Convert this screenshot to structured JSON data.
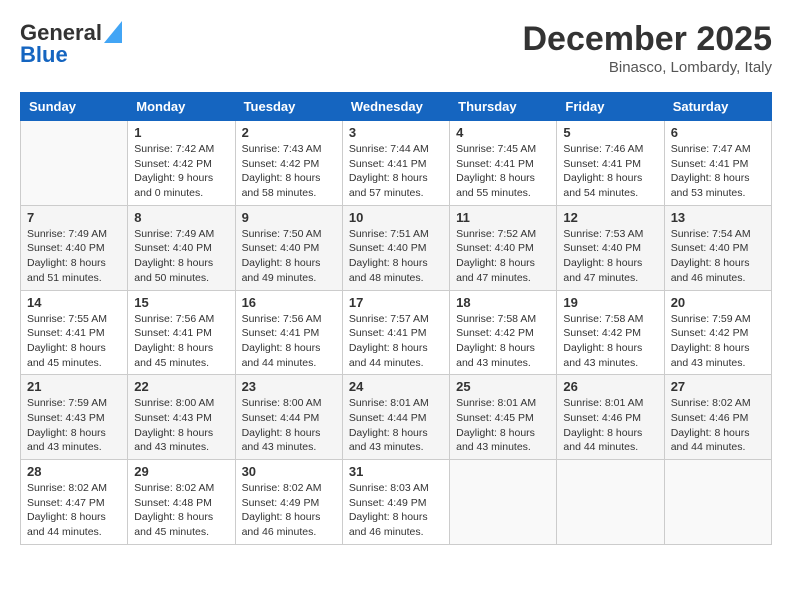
{
  "logo": {
    "line1": "General",
    "line2": "Blue"
  },
  "title": "December 2025",
  "location": "Binasco, Lombardy, Italy",
  "days_header": [
    "Sunday",
    "Monday",
    "Tuesday",
    "Wednesday",
    "Thursday",
    "Friday",
    "Saturday"
  ],
  "weeks": [
    [
      {
        "day": "",
        "info": ""
      },
      {
        "day": "1",
        "info": "Sunrise: 7:42 AM\nSunset: 4:42 PM\nDaylight: 9 hours\nand 0 minutes."
      },
      {
        "day": "2",
        "info": "Sunrise: 7:43 AM\nSunset: 4:42 PM\nDaylight: 8 hours\nand 58 minutes."
      },
      {
        "day": "3",
        "info": "Sunrise: 7:44 AM\nSunset: 4:41 PM\nDaylight: 8 hours\nand 57 minutes."
      },
      {
        "day": "4",
        "info": "Sunrise: 7:45 AM\nSunset: 4:41 PM\nDaylight: 8 hours\nand 55 minutes."
      },
      {
        "day": "5",
        "info": "Sunrise: 7:46 AM\nSunset: 4:41 PM\nDaylight: 8 hours\nand 54 minutes."
      },
      {
        "day": "6",
        "info": "Sunrise: 7:47 AM\nSunset: 4:41 PM\nDaylight: 8 hours\nand 53 minutes."
      }
    ],
    [
      {
        "day": "7",
        "info": "Sunrise: 7:49 AM\nSunset: 4:40 PM\nDaylight: 8 hours\nand 51 minutes."
      },
      {
        "day": "8",
        "info": "Sunrise: 7:49 AM\nSunset: 4:40 PM\nDaylight: 8 hours\nand 50 minutes."
      },
      {
        "day": "9",
        "info": "Sunrise: 7:50 AM\nSunset: 4:40 PM\nDaylight: 8 hours\nand 49 minutes."
      },
      {
        "day": "10",
        "info": "Sunrise: 7:51 AM\nSunset: 4:40 PM\nDaylight: 8 hours\nand 48 minutes."
      },
      {
        "day": "11",
        "info": "Sunrise: 7:52 AM\nSunset: 4:40 PM\nDaylight: 8 hours\nand 47 minutes."
      },
      {
        "day": "12",
        "info": "Sunrise: 7:53 AM\nSunset: 4:40 PM\nDaylight: 8 hours\nand 47 minutes."
      },
      {
        "day": "13",
        "info": "Sunrise: 7:54 AM\nSunset: 4:40 PM\nDaylight: 8 hours\nand 46 minutes."
      }
    ],
    [
      {
        "day": "14",
        "info": "Sunrise: 7:55 AM\nSunset: 4:41 PM\nDaylight: 8 hours\nand 45 minutes."
      },
      {
        "day": "15",
        "info": "Sunrise: 7:56 AM\nSunset: 4:41 PM\nDaylight: 8 hours\nand 45 minutes."
      },
      {
        "day": "16",
        "info": "Sunrise: 7:56 AM\nSunset: 4:41 PM\nDaylight: 8 hours\nand 44 minutes."
      },
      {
        "day": "17",
        "info": "Sunrise: 7:57 AM\nSunset: 4:41 PM\nDaylight: 8 hours\nand 44 minutes."
      },
      {
        "day": "18",
        "info": "Sunrise: 7:58 AM\nSunset: 4:42 PM\nDaylight: 8 hours\nand 43 minutes."
      },
      {
        "day": "19",
        "info": "Sunrise: 7:58 AM\nSunset: 4:42 PM\nDaylight: 8 hours\nand 43 minutes."
      },
      {
        "day": "20",
        "info": "Sunrise: 7:59 AM\nSunset: 4:42 PM\nDaylight: 8 hours\nand 43 minutes."
      }
    ],
    [
      {
        "day": "21",
        "info": "Sunrise: 7:59 AM\nSunset: 4:43 PM\nDaylight: 8 hours\nand 43 minutes."
      },
      {
        "day": "22",
        "info": "Sunrise: 8:00 AM\nSunset: 4:43 PM\nDaylight: 8 hours\nand 43 minutes."
      },
      {
        "day": "23",
        "info": "Sunrise: 8:00 AM\nSunset: 4:44 PM\nDaylight: 8 hours\nand 43 minutes."
      },
      {
        "day": "24",
        "info": "Sunrise: 8:01 AM\nSunset: 4:44 PM\nDaylight: 8 hours\nand 43 minutes."
      },
      {
        "day": "25",
        "info": "Sunrise: 8:01 AM\nSunset: 4:45 PM\nDaylight: 8 hours\nand 43 minutes."
      },
      {
        "day": "26",
        "info": "Sunrise: 8:01 AM\nSunset: 4:46 PM\nDaylight: 8 hours\nand 44 minutes."
      },
      {
        "day": "27",
        "info": "Sunrise: 8:02 AM\nSunset: 4:46 PM\nDaylight: 8 hours\nand 44 minutes."
      }
    ],
    [
      {
        "day": "28",
        "info": "Sunrise: 8:02 AM\nSunset: 4:47 PM\nDaylight: 8 hours\nand 44 minutes."
      },
      {
        "day": "29",
        "info": "Sunrise: 8:02 AM\nSunset: 4:48 PM\nDaylight: 8 hours\nand 45 minutes."
      },
      {
        "day": "30",
        "info": "Sunrise: 8:02 AM\nSunset: 4:49 PM\nDaylight: 8 hours\nand 46 minutes."
      },
      {
        "day": "31",
        "info": "Sunrise: 8:03 AM\nSunset: 4:49 PM\nDaylight: 8 hours\nand 46 minutes."
      },
      {
        "day": "",
        "info": ""
      },
      {
        "day": "",
        "info": ""
      },
      {
        "day": "",
        "info": ""
      }
    ]
  ]
}
